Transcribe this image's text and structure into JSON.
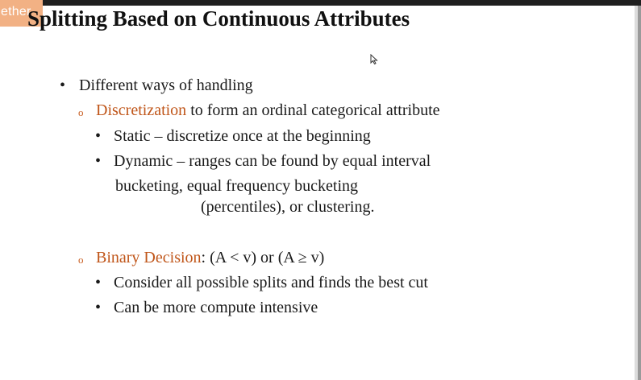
{
  "window": {
    "tag_text": "ether"
  },
  "slide": {
    "title": "Splitting Based on Continuous Attributes",
    "bullet_main": "Different ways of handling",
    "disc_term": "Discretization",
    "disc_rest": " to form an ordinal categorical attribute",
    "static_line": "Static – discretize once at the beginning",
    "dynamic_line1": "Dynamic – ranges can be found by equal interval",
    "dynamic_line2": "bucketing, equal frequency bucketing",
    "dynamic_line3": "(percentiles), or clustering.",
    "binary_term": "Binary Decision",
    "binary_rest": ": (A < v) or (A ≥ v)",
    "splits_line": "Consider all possible splits and finds the best cut",
    "compute_line": "Can be more compute intensive",
    "bullet_char": "•",
    "sub_bullet_char": "o"
  },
  "colors": {
    "accent": "#c0561a",
    "tag": "#f2b184"
  },
  "icons": {
    "cursor": "mouse-pointer-icon"
  }
}
